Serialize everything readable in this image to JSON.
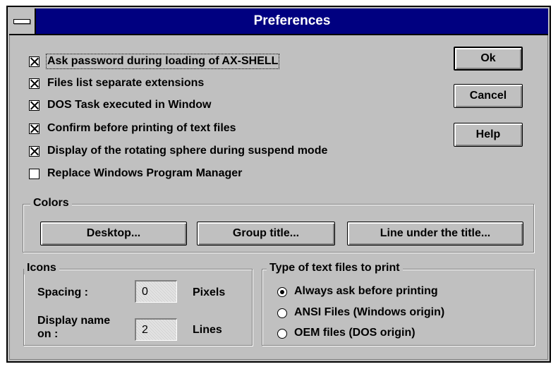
{
  "window": {
    "title": "Preferences"
  },
  "options": [
    {
      "label": "Ask password during loading of AX-SHELL",
      "checked": true
    },
    {
      "label": "Files list separate extensions",
      "checked": true
    },
    {
      "label": "DOS Task executed in Window",
      "checked": true
    },
    {
      "label": "Confirm before printing of text files",
      "checked": true
    },
    {
      "label": "Display of the rotating sphere during suspend mode",
      "checked": true
    },
    {
      "label": "Replace Windows Program Manager",
      "checked": false
    }
  ],
  "buttons": {
    "ok": "Ok",
    "cancel": "Cancel",
    "help": "Help"
  },
  "colors": {
    "title": "Colors",
    "buttons": [
      "Desktop...",
      "Group title...",
      "Line under the title..."
    ]
  },
  "icons": {
    "title": "Icons",
    "spacing_label": "Spacing :",
    "spacing_value": "0",
    "spacing_unit": "Pixels",
    "display_label_1": "Display name",
    "display_label_2": "on :",
    "display_value": "2",
    "display_unit": "Lines"
  },
  "print_type": {
    "title": "Type of text files to print",
    "options": [
      {
        "label": "Always ask before printing",
        "selected": true
      },
      {
        "label": "ANSI Files (Windows origin)",
        "selected": false
      },
      {
        "label": "OEM files (DOS origin)",
        "selected": false
      }
    ]
  },
  "theme": {
    "titlebar": "#000080",
    "face": "#c0c0c0"
  }
}
